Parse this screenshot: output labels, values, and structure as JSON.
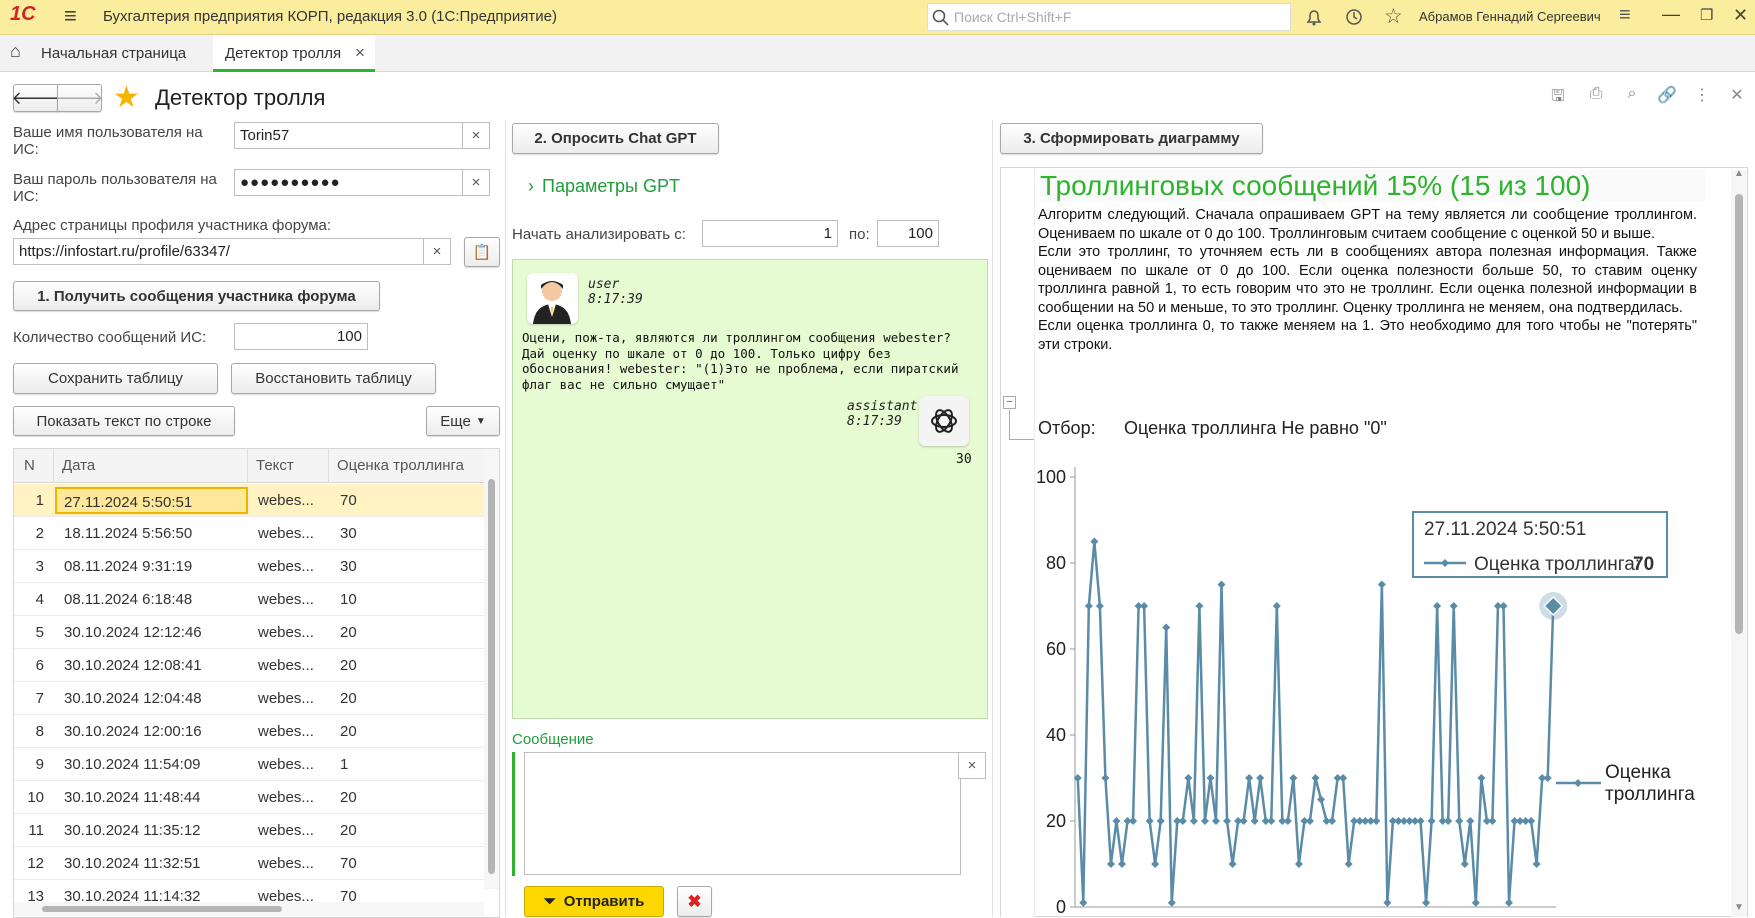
{
  "app": {
    "title": "Бухгалтерия предприятия КОРП, редакция 3.0  (1С:Предприятие)",
    "search_placeholder": "Поиск Ctrl+Shift+F",
    "user": "Абрамов Геннадий Сергеевич",
    "logo": "1С"
  },
  "tabs": [
    {
      "label": "Начальная страница"
    },
    {
      "label": "Детектор тролля",
      "close": "×"
    }
  ],
  "form": {
    "title": "Детектор тролля"
  },
  "left": {
    "username_label": "Ваше имя пользователя на ИС:",
    "username_value": "Torin57",
    "password_label": "Ваш пароль пользователя на ИС:",
    "password_value": "●●●●●●●●●●",
    "profile_label": "Адрес страницы профиля участника форума:",
    "profile_value": "https://infostart.ru/profile/63347/",
    "get_messages_button": "1. Получить сообщения участника форума",
    "count_label": "Количество сообщений ИС:",
    "count_value": "100",
    "save_table_button": "Сохранить таблицу",
    "restore_table_button": "Восстановить таблицу",
    "show_text_button": "Показать текст по строке",
    "more_button": "Еще",
    "columns": [
      "N",
      "Дата",
      "Текст",
      "Оценка троллинга"
    ],
    "rows": [
      {
        "n": "1",
        "date": "27.11.2024 5:50:51",
        "text": "webester",
        "score": "70"
      },
      {
        "n": "2",
        "date": "18.11.2024 5:56:50",
        "text": "webester",
        "score": "30"
      },
      {
        "n": "3",
        "date": "08.11.2024 9:31:19",
        "text": "webester",
        "score": "30"
      },
      {
        "n": "4",
        "date": "08.11.2024 6:18:48",
        "text": "webester",
        "score": "10"
      },
      {
        "n": "5",
        "date": "30.10.2024 12:12:46",
        "text": "webester",
        "score": "20"
      },
      {
        "n": "6",
        "date": "30.10.2024 12:08:41",
        "text": "webester",
        "score": "20"
      },
      {
        "n": "7",
        "date": "30.10.2024 12:04:48",
        "text": "webester",
        "score": "20"
      },
      {
        "n": "8",
        "date": "30.10.2024 12:00:16",
        "text": "webester",
        "score": "20"
      },
      {
        "n": "9",
        "date": "30.10.2024 11:54:09",
        "text": "webester",
        "score": "1"
      },
      {
        "n": "10",
        "date": "30.10.2024 11:48:44",
        "text": "webester",
        "score": "20"
      },
      {
        "n": "11",
        "date": "30.10.2024 11:35:12",
        "text": "webester",
        "score": "20"
      },
      {
        "n": "12",
        "date": "30.10.2024 11:32:51",
        "text": "webester",
        "score": "70"
      },
      {
        "n": "13",
        "date": "30.10.2024 11:14:32",
        "text": "webester",
        "score": "70"
      }
    ]
  },
  "middle": {
    "ask_gpt_button": "2. Опросить Chat GPT",
    "gpt_params": "Параметры GPT",
    "start_label": "Начать анализировать с:",
    "start_value": "1",
    "to_label": "по:",
    "to_value": "100",
    "chat": {
      "user_name": "user",
      "user_time": "8:17:39",
      "user_text": "Оцени, пож-та, являются ли троллингом сообщения webester? Дай оценку по шкале от 0 до 100. Только цифру без обоснования! webester: \"(1)Это не проблема, если пиратский флаг вас не сильно смущает\"",
      "assistant_name": "assistant",
      "assistant_time": "8:17:39",
      "assistant_text": "30"
    },
    "message_label": "Сообщение",
    "send_button": "Отправить"
  },
  "right": {
    "make_chart_button": "3. Сформировать диаграмму",
    "heading": "Троллинговых сообщений 15% (15 из 100)",
    "description": "Алгоритм следующий. Сначала опрашиваем GPT на тему является ли сообщение троллингом. Оцениваем по шкале от 0 до 100. Троллинговым считаем сообщение с оценкой 50 и выше.\nЕсли это троллинг, то уточняем есть ли в сообщениях автора полезная информация. Также оцениваем по шкале от 0 до 100. Если оценка полезности больше 50, то ставим оценку троллинга равной 1, то есть говорим что это не троллинг. Если оценка полезной информации  в сообщении на 50 и меньше, то это троллинг. Оценку троллинга не меняем, она подтвердилась.\nЕсли оценка троллинга 0, то также меняем на 1. Это необходимо для того чтобы не \"потерять\" эти строки.",
    "filter_label": "Отбор:",
    "filter_value": "Оценка троллинга Не равно \"0\"",
    "tooltip_date": "27.11.2024 5:50:51",
    "tooltip_series": "Оценка троллинга:",
    "tooltip_value": "70"
  },
  "colors": {
    "accent": "#fbed9e",
    "green": "#2db32d",
    "chat_bg": "#e6fbd2",
    "series": "#5a8ca8",
    "selected_row": "#fff3c4"
  },
  "chart_data": {
    "type": "line",
    "title": "",
    "ylabel": "",
    "xlabel": "",
    "ylim": [
      0,
      100
    ],
    "yticks": [
      0,
      20,
      40,
      60,
      80,
      100
    ],
    "legend": "right",
    "series": [
      {
        "name": "Оценка троллинга",
        "values": [
          30,
          1,
          70,
          85,
          70,
          30,
          10,
          20,
          10,
          20,
          20,
          70,
          70,
          20,
          10,
          20,
          65,
          1,
          20,
          20,
          30,
          20,
          70,
          20,
          30,
          20,
          75,
          20,
          10,
          20,
          20,
          30,
          20,
          30,
          20,
          20,
          70,
          20,
          20,
          30,
          10,
          20,
          20,
          30,
          25,
          20,
          20,
          30,
          30,
          10,
          20,
          20,
          20,
          20,
          20,
          75,
          1,
          20,
          20,
          20,
          20,
          20,
          20,
          1,
          20,
          70,
          20,
          20,
          70,
          20,
          10,
          20,
          1,
          30,
          20,
          20,
          70,
          70,
          1,
          20,
          20,
          20,
          20,
          10,
          30,
          30,
          70
        ]
      }
    ]
  }
}
